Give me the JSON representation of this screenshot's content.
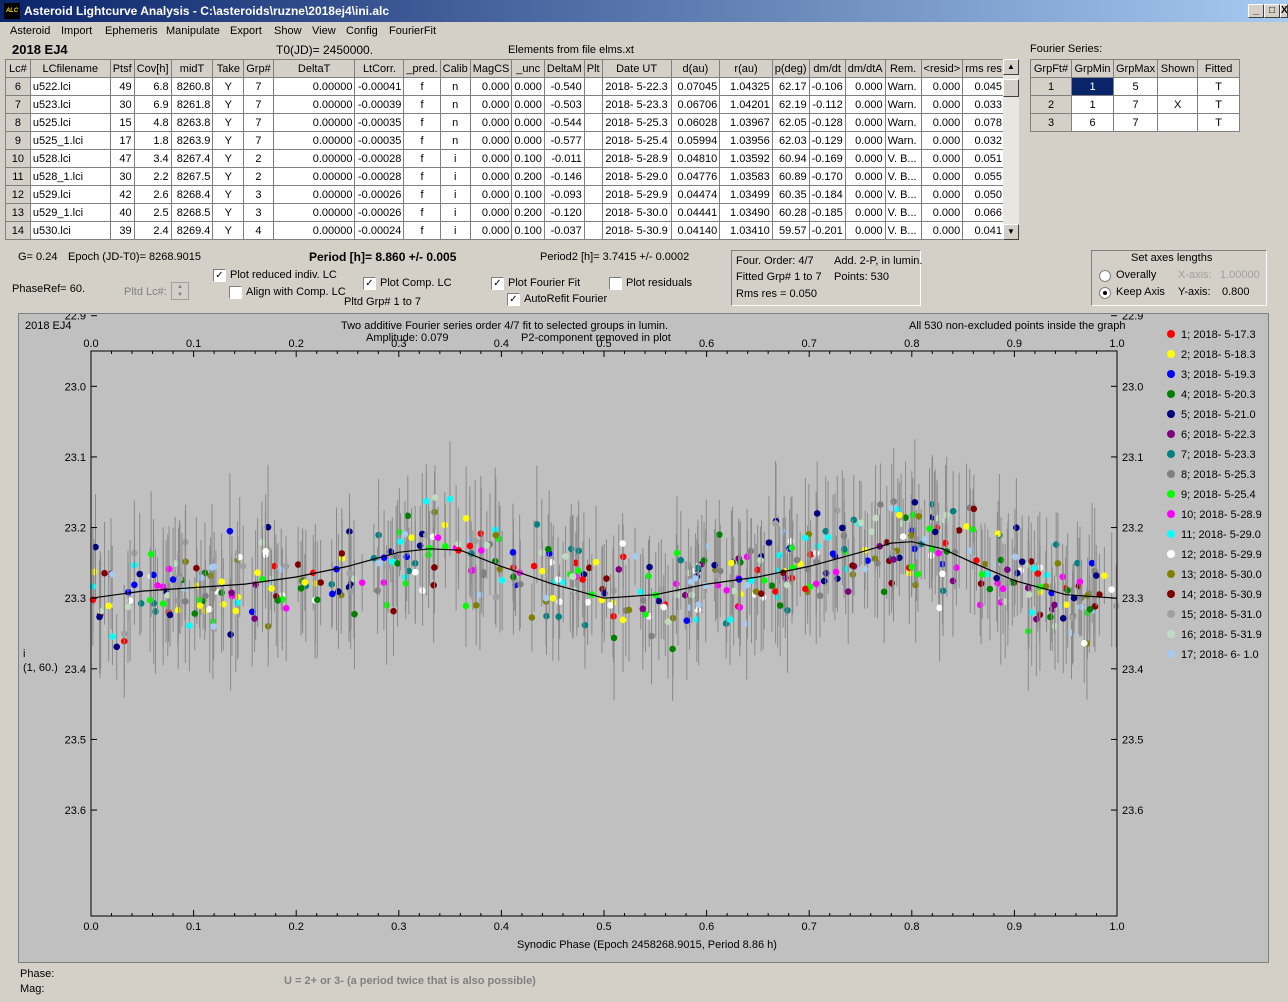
{
  "window": {
    "title": "Asteroid Lightcurve Analysis - C:\\asteroids\\ruzne\\2018ej4\\ini.alc",
    "app_icon": "ALC",
    "min": "_",
    "max": "□",
    "close": "X"
  },
  "menu": [
    "Asteroid",
    "Import",
    "Ephemeris",
    "Manipulate",
    "Export",
    "Show",
    "View",
    "Config",
    "FourierFit"
  ],
  "header": {
    "asteroid": "2018 EJ4",
    "t0": "T0(JD)= 2450000.",
    "elements": "Elements from file elms.xt",
    "fourier_title": "Fourier Series:"
  },
  "lc_table": {
    "columns": [
      "Lc#",
      "LCfilename",
      "Ptsf",
      "Cov[h]",
      "midT",
      "Take",
      "Grp#",
      "DeltaT",
      "LtCorr.",
      "_pred.",
      "Calib",
      "MagCS",
      "_unc",
      "DeltaM",
      "Plt",
      "Date UT",
      "d(au)",
      "r(au)",
      "p(deg)",
      "dm/dt",
      "dm/dtA",
      "Rem.",
      "<resid>",
      "rms res"
    ],
    "rows": [
      [
        "6",
        "u522.lci",
        "49",
        "6.8",
        "8260.8",
        "Y",
        "7",
        "0.00000",
        "-0.00041",
        "f",
        "n",
        "0.000",
        "0.000",
        "-0.540",
        "",
        "2018- 5-22.3",
        "0.07045",
        "1.04325",
        "62.17",
        "-0.106",
        "0.000",
        "Warn.",
        "0.000",
        "0.045"
      ],
      [
        "7",
        "u523.lci",
        "30",
        "6.9",
        "8261.8",
        "Y",
        "7",
        "0.00000",
        "-0.00039",
        "f",
        "n",
        "0.000",
        "0.000",
        "-0.503",
        "",
        "2018- 5-23.3",
        "0.06706",
        "1.04201",
        "62.19",
        "-0.112",
        "0.000",
        "Warn.",
        "0.000",
        "0.033"
      ],
      [
        "8",
        "u525.lci",
        "15",
        "4.8",
        "8263.8",
        "Y",
        "7",
        "0.00000",
        "-0.00035",
        "f",
        "n",
        "0.000",
        "0.000",
        "-0.544",
        "",
        "2018- 5-25.3",
        "0.06028",
        "1.03967",
        "62.05",
        "-0.128",
        "0.000",
        "Warn.",
        "0.000",
        "0.078"
      ],
      [
        "9",
        "u525_1.lci",
        "17",
        "1.8",
        "8263.9",
        "Y",
        "7",
        "0.00000",
        "-0.00035",
        "f",
        "n",
        "0.000",
        "0.000",
        "-0.577",
        "",
        "2018- 5-25.4",
        "0.05994",
        "1.03956",
        "62.03",
        "-0.129",
        "0.000",
        "Warn.",
        "0.000",
        "0.032"
      ],
      [
        "10",
        "u528.lci",
        "47",
        "3.4",
        "8267.4",
        "Y",
        "2",
        "0.00000",
        "-0.00028",
        "f",
        "i",
        "0.000",
        "0.100",
        "-0.011",
        "",
        "2018- 5-28.9",
        "0.04810",
        "1.03592",
        "60.94",
        "-0.169",
        "0.000",
        "V. B...",
        "0.000",
        "0.051"
      ],
      [
        "11",
        "u528_1.lci",
        "30",
        "2.2",
        "8267.5",
        "Y",
        "2",
        "0.00000",
        "-0.00028",
        "f",
        "i",
        "0.000",
        "0.200",
        "-0.146",
        "",
        "2018- 5-29.0",
        "0.04776",
        "1.03583",
        "60.89",
        "-0.170",
        "0.000",
        "V. B...",
        "0.000",
        "0.055"
      ],
      [
        "12",
        "u529.lci",
        "42",
        "2.6",
        "8268.4",
        "Y",
        "3",
        "0.00000",
        "-0.00026",
        "f",
        "i",
        "0.000",
        "0.100",
        "-0.093",
        "",
        "2018- 5-29.9",
        "0.04474",
        "1.03499",
        "60.35",
        "-0.184",
        "0.000",
        "V. B...",
        "0.000",
        "0.050"
      ],
      [
        "13",
        "u529_1.lci",
        "40",
        "2.5",
        "8268.5",
        "Y",
        "3",
        "0.00000",
        "-0.00026",
        "f",
        "i",
        "0.000",
        "0.200",
        "-0.120",
        "",
        "2018- 5-30.0",
        "0.04441",
        "1.03490",
        "60.28",
        "-0.185",
        "0.000",
        "V. B...",
        "0.000",
        "0.066"
      ],
      [
        "14",
        "u530.lci",
        "39",
        "2.4",
        "8269.4",
        "Y",
        "4",
        "0.00000",
        "-0.00024",
        "f",
        "i",
        "0.000",
        "0.100",
        "-0.037",
        "",
        "2018- 5-30.9",
        "0.04140",
        "1.03410",
        "59.57",
        "-0.201",
        "0.000",
        "V. B...",
        "0.000",
        "0.041"
      ]
    ]
  },
  "fourier_table": {
    "columns": [
      "GrpFt#",
      "GrpMin",
      "GrpMax",
      "Shown",
      "Fitted"
    ],
    "rows": [
      [
        "1",
        "1",
        "5",
        "",
        "T"
      ],
      [
        "2",
        "1",
        "7",
        "X",
        "T"
      ],
      [
        "3",
        "6",
        "7",
        "",
        "T"
      ]
    ]
  },
  "info": {
    "g": "G= 0.24",
    "epoch": "Epoch (JD-T0)= 8268.9015",
    "period": "Period [h]= 8.860 +/- 0.005",
    "period2": "Period2 [h]= 3.7415 +/- 0.0002",
    "phaseref": "PhaseRef= 60.",
    "pltd_lc": "Pltd Lc#:",
    "four_order": "Four. Order:  4/7",
    "add": "Add. 2-P, in lumin.",
    "fitted_grp": "Fitted Grp# 1 to 7",
    "points": "Points: 530",
    "rms": "Rms res     = 0.050"
  },
  "options": {
    "plot_reduced": {
      "label": "Plot reduced indiv. LC",
      "checked": true
    },
    "align_comp": {
      "label": "Align with Comp. LC",
      "checked": false
    },
    "plot_comp": {
      "label": "Plot Comp. LC",
      "checked": true
    },
    "pltd_grp": "Pltd Grp#  1   to   7",
    "plot_fourier": {
      "label": "Plot Fourier Fit",
      "checked": true
    },
    "autorefit": {
      "label": "AutoRefit Fourier",
      "checked": true
    },
    "plot_resid": {
      "label": "Plot residuals",
      "checked": false
    }
  },
  "axes_box": {
    "title": "Set axes lengths",
    "overally": "Overally",
    "keep": "Keep Axis",
    "xaxis_label": "X-axis:",
    "xaxis_val": "1.00000",
    "yaxis_label": "Y-axis:",
    "yaxis_val": "0.800",
    "selected": "Keep Axis"
  },
  "plot_text": {
    "name": "2018 EJ4",
    "title1": "Two additive Fourier series order 4/7 fit to selected groups in lumin.",
    "title2_amp": "Amplitude: 0.079",
    "title2_p2": "P2-component removed in plot",
    "note": "All 530 non-excluded points inside the graph",
    "ylabel1": "i",
    "ylabel2": "(1, 60.)"
  },
  "chart_data": {
    "type": "scatter",
    "xlabel": "Synodic Phase (Epoch 2458268.9015, Period 8.86 h)",
    "xlim": [
      0.0,
      1.0
    ],
    "ylim": [
      23.75,
      22.95
    ],
    "x_ticks": [
      "0.0",
      "0.1",
      "0.2",
      "0.3",
      "0.4",
      "0.5",
      "0.6",
      "0.7",
      "0.8",
      "0.9",
      "1.0"
    ],
    "y_ticks": [
      "22.9",
      "23.0",
      "23.1",
      "23.2",
      "23.3",
      "23.4",
      "23.5",
      "23.6"
    ],
    "y_tick_values": [
      22.9,
      23.0,
      23.1,
      23.2,
      23.3,
      23.4,
      23.5,
      23.6
    ],
    "grid": false,
    "legend_position": "right",
    "series": [
      {
        "name": "1; 2018- 5-17.3",
        "color": "#ff0000"
      },
      {
        "name": "2; 2018- 5-18.3",
        "color": "#ffff00"
      },
      {
        "name": "3; 2018- 5-19.3",
        "color": "#0000ff"
      },
      {
        "name": "4; 2018- 5-20.3",
        "color": "#008000"
      },
      {
        "name": "5; 2018- 5-21.0",
        "color": "#000080"
      },
      {
        "name": "6; 2018- 5-22.3",
        "color": "#800080"
      },
      {
        "name": "7; 2018- 5-23.3",
        "color": "#008080"
      },
      {
        "name": "8; 2018- 5-25.3",
        "color": "#808080"
      },
      {
        "name": "9; 2018- 5-25.4",
        "color": "#00ff00"
      },
      {
        "name": "10; 2018- 5-28.9",
        "color": "#ff00ff"
      },
      {
        "name": "11; 2018- 5-29.0",
        "color": "#00ffff"
      },
      {
        "name": "12; 2018- 5-29.9",
        "color": "#ffffff"
      },
      {
        "name": "13; 2018- 5-30.0",
        "color": "#808000"
      },
      {
        "name": "14; 2018- 5-30.9",
        "color": "#800000"
      },
      {
        "name": "15; 2018- 5-31.0",
        "color": "#a0a0a0"
      },
      {
        "name": "16; 2018- 5-31.9",
        "color": "#c0dcc0"
      },
      {
        "name": "17; 2018- 6- 1.0",
        "color": "#a6caf0"
      }
    ],
    "fit_curve": {
      "x": [
        0.0,
        0.05,
        0.1,
        0.15,
        0.2,
        0.25,
        0.3,
        0.33,
        0.36,
        0.4,
        0.45,
        0.5,
        0.55,
        0.6,
        0.65,
        0.7,
        0.75,
        0.78,
        0.8,
        0.83,
        0.86,
        0.9,
        0.95,
        1.0
      ],
      "y": [
        23.3,
        23.29,
        23.285,
        23.28,
        23.27,
        23.255,
        23.235,
        23.23,
        23.232,
        23.255,
        23.28,
        23.3,
        23.295,
        23.28,
        23.27,
        23.255,
        23.235,
        23.222,
        23.22,
        23.23,
        23.25,
        23.275,
        23.295,
        23.3
      ]
    },
    "scatter_points_note": "530"
  },
  "status": {
    "phase": "Phase:",
    "mag": "Mag:",
    "hint": "U = 2+ or 3- (a period twice that is also possible)"
  }
}
